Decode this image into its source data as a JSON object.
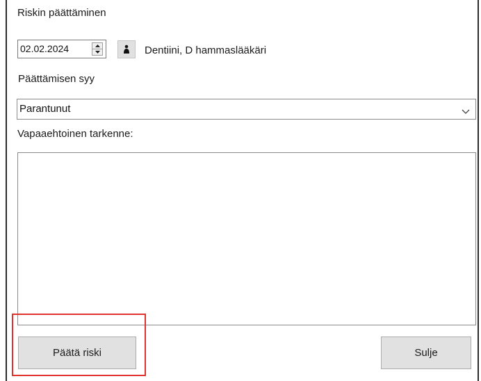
{
  "dialog": {
    "title": "Riskin päättäminen"
  },
  "date": {
    "value": "02.02.2024"
  },
  "author": {
    "name": "Dentiini, D hammaslääkäri"
  },
  "reason": {
    "label": "Päättämisen syy",
    "selected": "Parantunut"
  },
  "note": {
    "label": "Vapaaehtoinen tarkenne:",
    "value": ""
  },
  "buttons": {
    "close_risk": "Päätä riski",
    "close": "Sulje"
  },
  "colors": {
    "highlight": "#e0312d"
  }
}
